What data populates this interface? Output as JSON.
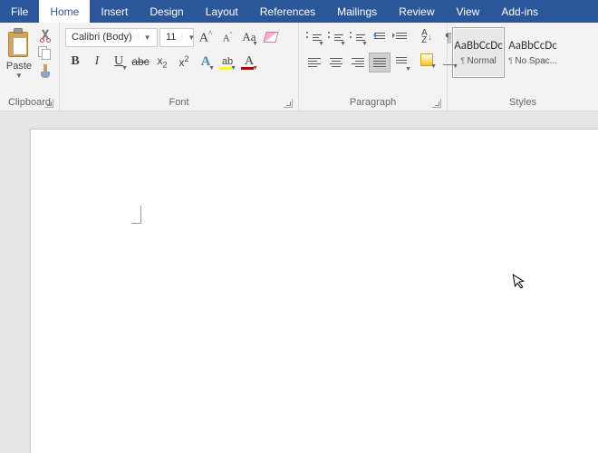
{
  "tabs": {
    "file": "File",
    "home": "Home",
    "insert": "Insert",
    "design": "Design",
    "layout": "Layout",
    "references": "References",
    "mailings": "Mailings",
    "review": "Review",
    "view": "View",
    "addins": "Add-ins"
  },
  "clipboard": {
    "paste": "Paste",
    "label": "Clipboard"
  },
  "font": {
    "name": "Calibri (Body)",
    "size": "11",
    "label": "Font"
  },
  "paragraph": {
    "label": "Paragraph"
  },
  "styles": {
    "label": "Styles",
    "items": [
      {
        "preview": "AaBbCcDc",
        "name": "Normal"
      },
      {
        "preview": "AaBbCcDc",
        "name": "No Spac..."
      }
    ]
  }
}
